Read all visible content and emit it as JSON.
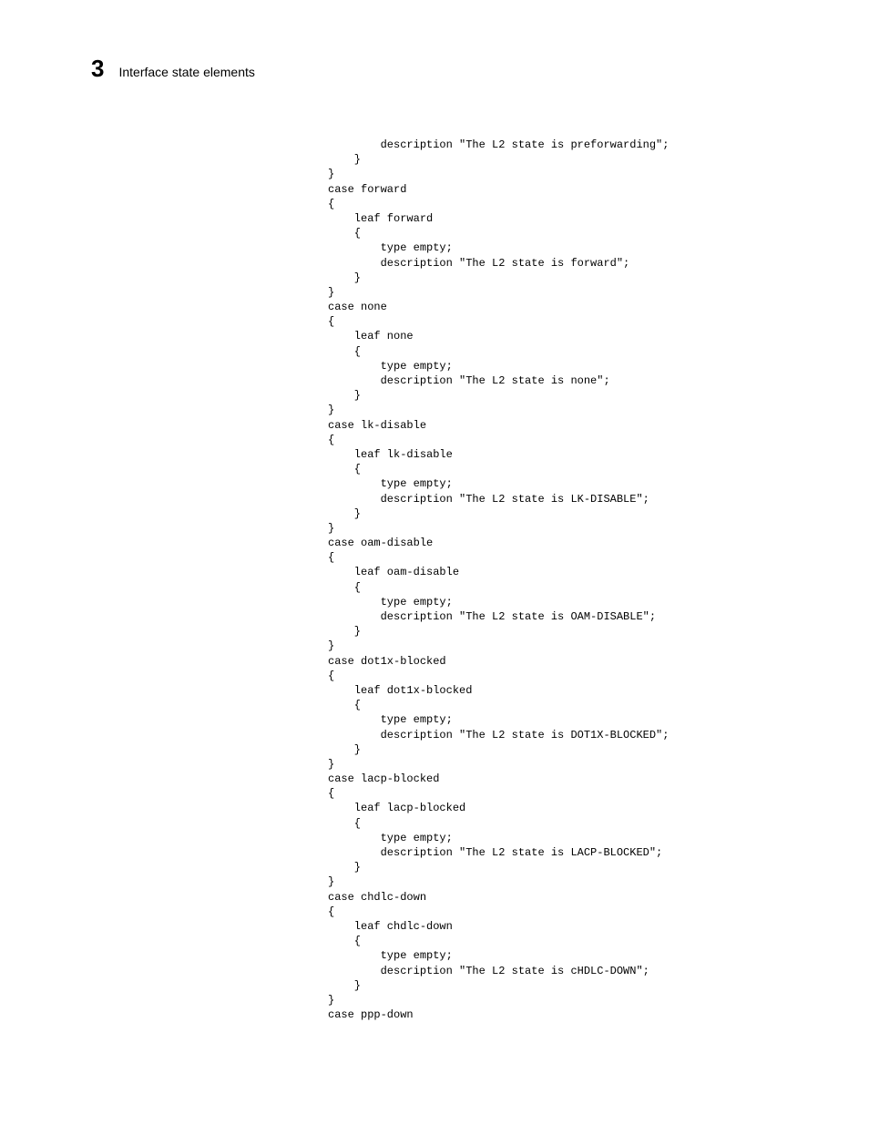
{
  "header": {
    "chapter_num": "3",
    "chapter_title": "Interface state elements"
  },
  "code": "        description \"The L2 state is preforwarding\";\n    }\n}\ncase forward\n{\n    leaf forward\n    {\n        type empty;\n        description \"The L2 state is forward\";\n    }\n}\ncase none\n{\n    leaf none\n    {\n        type empty;\n        description \"The L2 state is none\";\n    }\n}\ncase lk-disable\n{\n    leaf lk-disable\n    {\n        type empty;\n        description \"The L2 state is LK-DISABLE\";\n    }\n}\ncase oam-disable\n{\n    leaf oam-disable\n    {\n        type empty;\n        description \"The L2 state is OAM-DISABLE\";\n    }\n}\ncase dot1x-blocked\n{\n    leaf dot1x-blocked\n    {\n        type empty;\n        description \"The L2 state is DOT1X-BLOCKED\";\n    }\n}\ncase lacp-blocked\n{\n    leaf lacp-blocked\n    {\n        type empty;\n        description \"The L2 state is LACP-BLOCKED\";\n    }\n}\ncase chdlc-down\n{\n    leaf chdlc-down\n    {\n        type empty;\n        description \"The L2 state is cHDLC-DOWN\";\n    }\n}\ncase ppp-down"
}
